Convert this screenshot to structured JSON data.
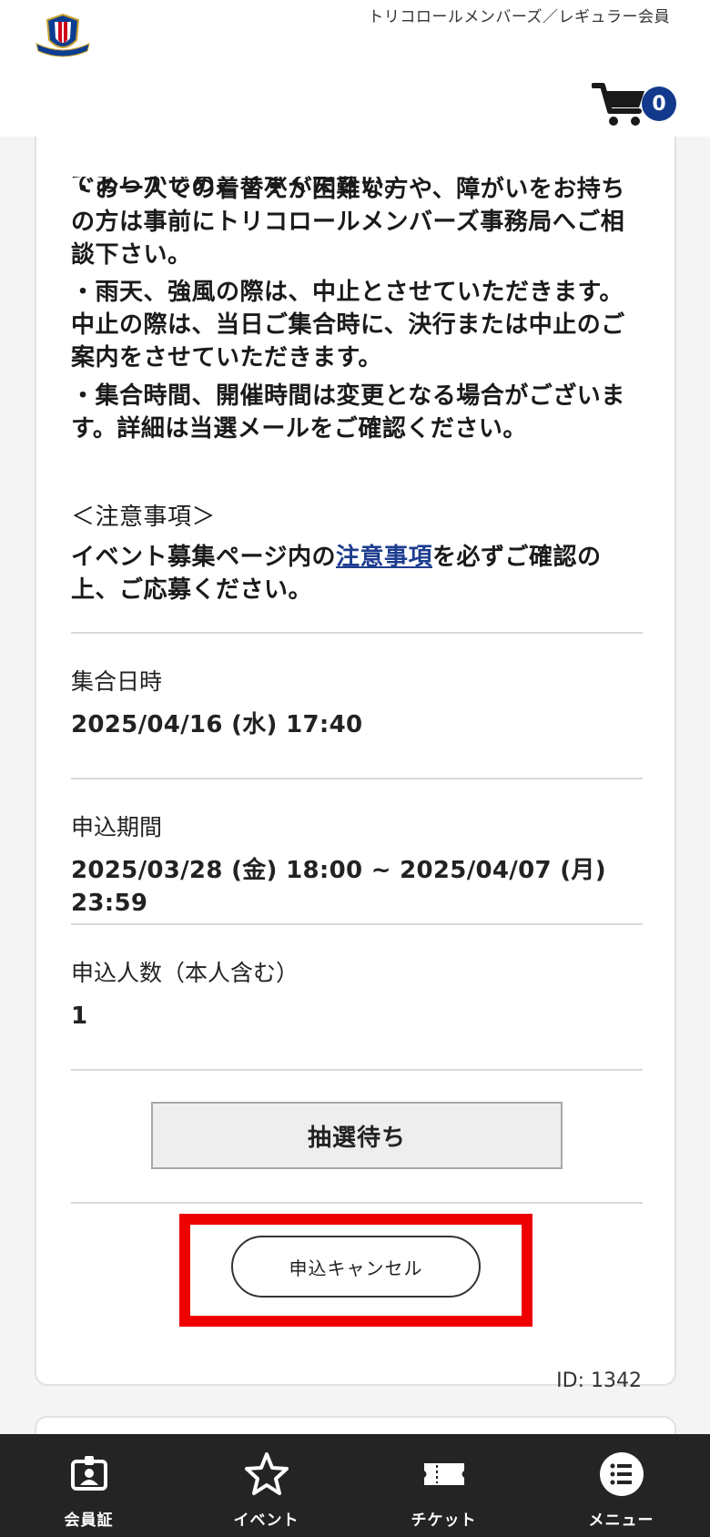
{
  "header": {
    "member_type": "トリコロールメンバーズ／レギュラー会員",
    "cart_count": "0",
    "logo_text": "Yokohama F·Marinos"
  },
  "notes": {
    "truncated_line": "であらかじめご了承ください。",
    "paragraph_1": [
      "・お一人での着替えが困難な方や、障がいをお持ち",
      "の方は事前にトリコロールメンバーズ事務局へご相",
      "談下さい。"
    ],
    "paragraph_2": [
      "・雨天、強風の際は、中止とさせていただきます。",
      "中止の際は、当日ご集合時に、決行または中止のご",
      "案内をさせていただきます。"
    ],
    "paragraph_3": [
      "・集合時間、開催時間は変更となる場合がございま",
      "す。詳細は当選メールをご確認ください。"
    ],
    "caution_heading": "＜注意事項＞",
    "caution_prefix": "イベント募集ページ内の",
    "caution_link": "注意事項",
    "caution_suffix": "を必ずご確認の",
    "caution_line2": "上、ご応募ください。"
  },
  "fields": {
    "meeting_label": "集合日時",
    "meeting_value": "2025/04/16 (水) 17:40",
    "period_label": "申込期間",
    "period_value": "2025/03/28 (金) 18:00 ~ 2025/04/07 (月) 23:59",
    "count_label": "申込人数（本人含む）",
    "count_value": "1"
  },
  "status_button": "抽選待ち",
  "cancel_button": "申込キャンセル",
  "record_id": "ID: 1342",
  "bottom_nav": [
    {
      "label": "会員証",
      "icon": "member-card-icon"
    },
    {
      "label": "イベント",
      "icon": "star-icon"
    },
    {
      "label": "チケット",
      "icon": "ticket-icon"
    },
    {
      "label": "メニュー",
      "icon": "menu-list-icon"
    }
  ],
  "colors": {
    "accent_blue": "#13398c",
    "highlight_red": "#ee0000",
    "nav_bg": "#242424"
  }
}
